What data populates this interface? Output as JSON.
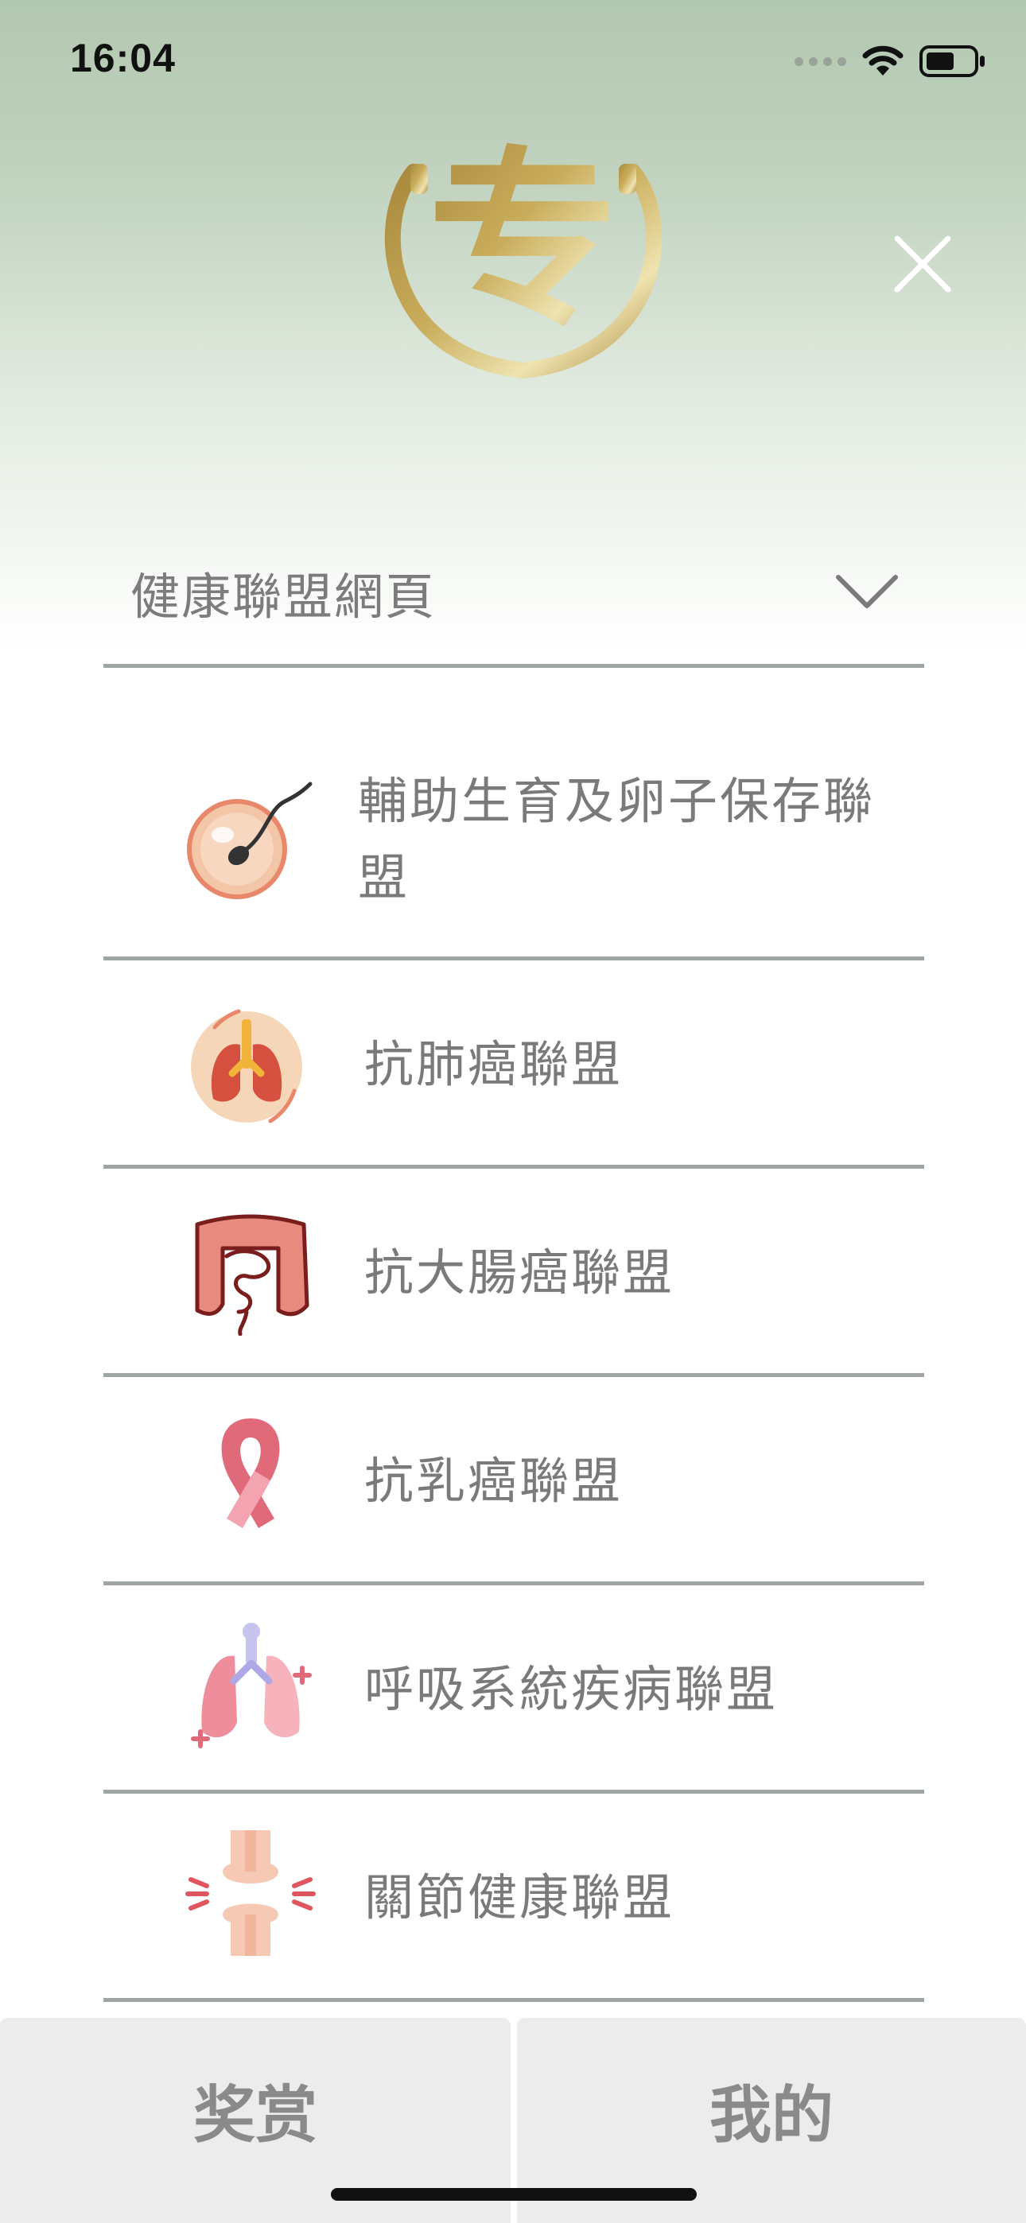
{
  "status_bar": {
    "time": "16:04",
    "signal_icon": "cellular-signal-icon",
    "wifi_icon": "wifi-icon",
    "battery_icon": "battery-icon"
  },
  "header": {
    "logo_glyph": "专",
    "logo_icon": "brand-logo",
    "close_icon": "close-icon",
    "accent_color": "#c9a84a"
  },
  "dropdown": {
    "selected": "健康聯盟網頁",
    "icon": "chevron-down-icon"
  },
  "alliances": [
    {
      "label": "輔助生育及卵子保存聯盟",
      "icon": "egg-sperm-icon"
    },
    {
      "label": "抗肺癌聯盟",
      "icon": "lungs-icon"
    },
    {
      "label": "抗大腸癌聯盟",
      "icon": "intestine-icon"
    },
    {
      "label": "抗乳癌聯盟",
      "icon": "pink-ribbon-icon"
    },
    {
      "label": "呼吸系統疾病聯盟",
      "icon": "respiratory-icon"
    },
    {
      "label": "關節健康聯盟",
      "icon": "joint-icon"
    }
  ],
  "tabs": {
    "left": "奖赏",
    "right": "我的"
  }
}
